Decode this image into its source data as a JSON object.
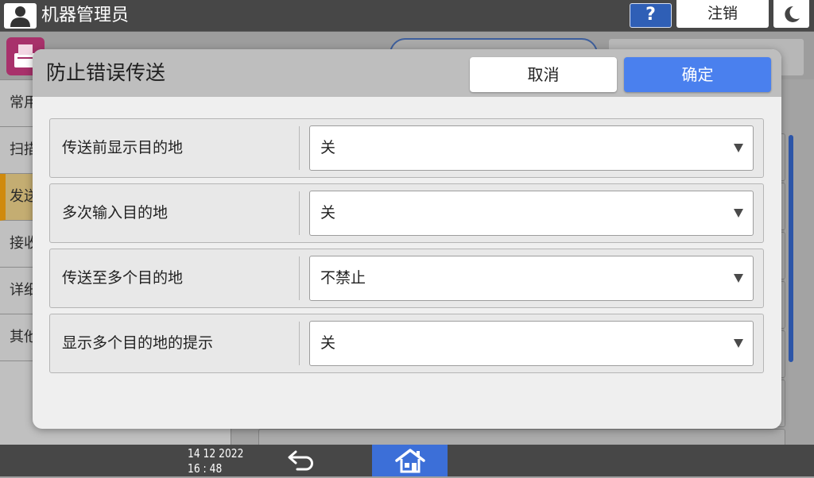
{
  "top_bar": {
    "user_label": "机器管理员",
    "help_label": "?",
    "logout_label": "注销"
  },
  "background": {
    "sidebar_items": [
      {
        "label": "常用"
      },
      {
        "label": "扫描"
      },
      {
        "label": "发送",
        "active": true
      },
      {
        "label": "接收"
      },
      {
        "label": "详细"
      },
      {
        "label": "其他"
      }
    ]
  },
  "dialog": {
    "title": "防止错误传送",
    "cancel_label": "取消",
    "ok_label": "确定",
    "settings": [
      {
        "label": "传送前显示目的地",
        "value": "关"
      },
      {
        "label": "多次输入目的地",
        "value": "关"
      },
      {
        "label": "传送至多个目的地",
        "value": "不禁止"
      },
      {
        "label": "显示多个目的地的提示",
        "value": "关"
      }
    ]
  },
  "bottom_bar": {
    "date": "14 12 2022",
    "time": "16 : 48"
  },
  "icons": {
    "user": "user-icon",
    "logout_mode": "moon-icon",
    "function": "fax-icon",
    "dropdown": "chevron-down-icon",
    "back": "back-icon",
    "home": "home-icon"
  },
  "colors": {
    "top_bar": "#474747",
    "accent_blue": "#4a80ee",
    "help_button": "#2f5fb6",
    "home_button": "#3c6fd8",
    "active_tab_marker": "#d08a0c",
    "function_icon": "#a8316b"
  }
}
